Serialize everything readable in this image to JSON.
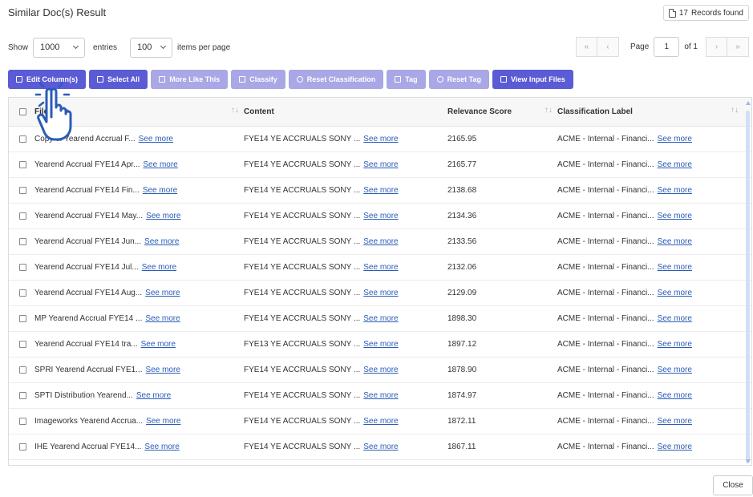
{
  "title": "Similar Doc(s) Result",
  "records": {
    "count": "17",
    "label": "Records found"
  },
  "controls": {
    "show_label": "Show",
    "entries_value": "1000",
    "entries_label": "entries",
    "per_page_value": "100",
    "per_page_label": "items per page"
  },
  "pager": {
    "first": "«",
    "prev": "‹",
    "page_label": "Page",
    "page_value": "1",
    "of_label": "of 1",
    "next": "›",
    "last": "»"
  },
  "toolbar": {
    "edit_columns": "Edit Column(s)",
    "select_all": "Select All",
    "more_like_this": "More Like This",
    "classify": "Classify",
    "reset_classification": "Reset Classification",
    "tag": "Tag",
    "reset_tag": "Reset Tag",
    "view_input_files": "View Input Files"
  },
  "table": {
    "headers": {
      "filename": "Filename",
      "content": "Content",
      "score": "Relevance Score",
      "label": "Classification Label"
    },
    "see_more": "See more",
    "rows": [
      {
        "filename": "Copy of Yearend Accrual F...",
        "content": "FYE14 YE ACCRUALS SONY ...",
        "score": "2165.95",
        "label": "ACME - Internal - Financi..."
      },
      {
        "filename": "Yearend Accrual FYE14 Apr...",
        "content": "FYE14 YE ACCRUALS SONY ...",
        "score": "2165.77",
        "label": "ACME - Internal - Financi..."
      },
      {
        "filename": "Yearend Accrual FYE14 Fin...",
        "content": "FYE14 YE ACCRUALS SONY ...",
        "score": "2138.68",
        "label": "ACME - Internal - Financi..."
      },
      {
        "filename": "Yearend Accrual FYE14 May...",
        "content": "FYE14 YE ACCRUALS SONY ...",
        "score": "2134.36",
        "label": "ACME - Internal - Financi..."
      },
      {
        "filename": "Yearend Accrual FYE14 Jun...",
        "content": "FYE14 YE ACCRUALS SONY ...",
        "score": "2133.56",
        "label": "ACME - Internal - Financi..."
      },
      {
        "filename": "Yearend Accrual FYE14 Jul...",
        "content": "FYE14 YE ACCRUALS SONY ...",
        "score": "2132.06",
        "label": "ACME - Internal - Financi..."
      },
      {
        "filename": "Yearend Accrual FYE14 Aug...",
        "content": "FYE14 YE ACCRUALS SONY ...",
        "score": "2129.09",
        "label": "ACME - Internal - Financi..."
      },
      {
        "filename": "MP Yearend Accrual FYE14 ...",
        "content": "FYE14 YE ACCRUALS SONY ...",
        "score": "1898.30",
        "label": "ACME - Internal - Financi..."
      },
      {
        "filename": "Yearend Accrual FYE14 tra...",
        "content": "FYE13 YE ACCRUALS SONY ...",
        "score": "1897.12",
        "label": "ACME - Internal - Financi..."
      },
      {
        "filename": "SPRI Yearend Accrual FYE1...",
        "content": "FYE14 YE ACCRUALS SONY ...",
        "score": "1878.90",
        "label": "ACME - Internal - Financi..."
      },
      {
        "filename": "SPTI Distribution Yearend...",
        "content": "FYE14 YE ACCRUALS SONY ...",
        "score": "1874.97",
        "label": "ACME - Internal - Financi..."
      },
      {
        "filename": "Imageworks Yearend Accrua...",
        "content": "FYE14 YE ACCRUALS SONY ...",
        "score": "1872.11",
        "label": "ACME - Internal - Financi..."
      },
      {
        "filename": "IHE Yearend Accrual FYE14...",
        "content": "FYE14 YE ACCRUALS SONY ...",
        "score": "1867.11",
        "label": "ACME - Internal - Financi..."
      }
    ]
  },
  "close_label": "Close",
  "colors": {
    "primary": "#5b5bd6",
    "disabled": "#a9a7e6",
    "link": "#2a5cb8"
  }
}
